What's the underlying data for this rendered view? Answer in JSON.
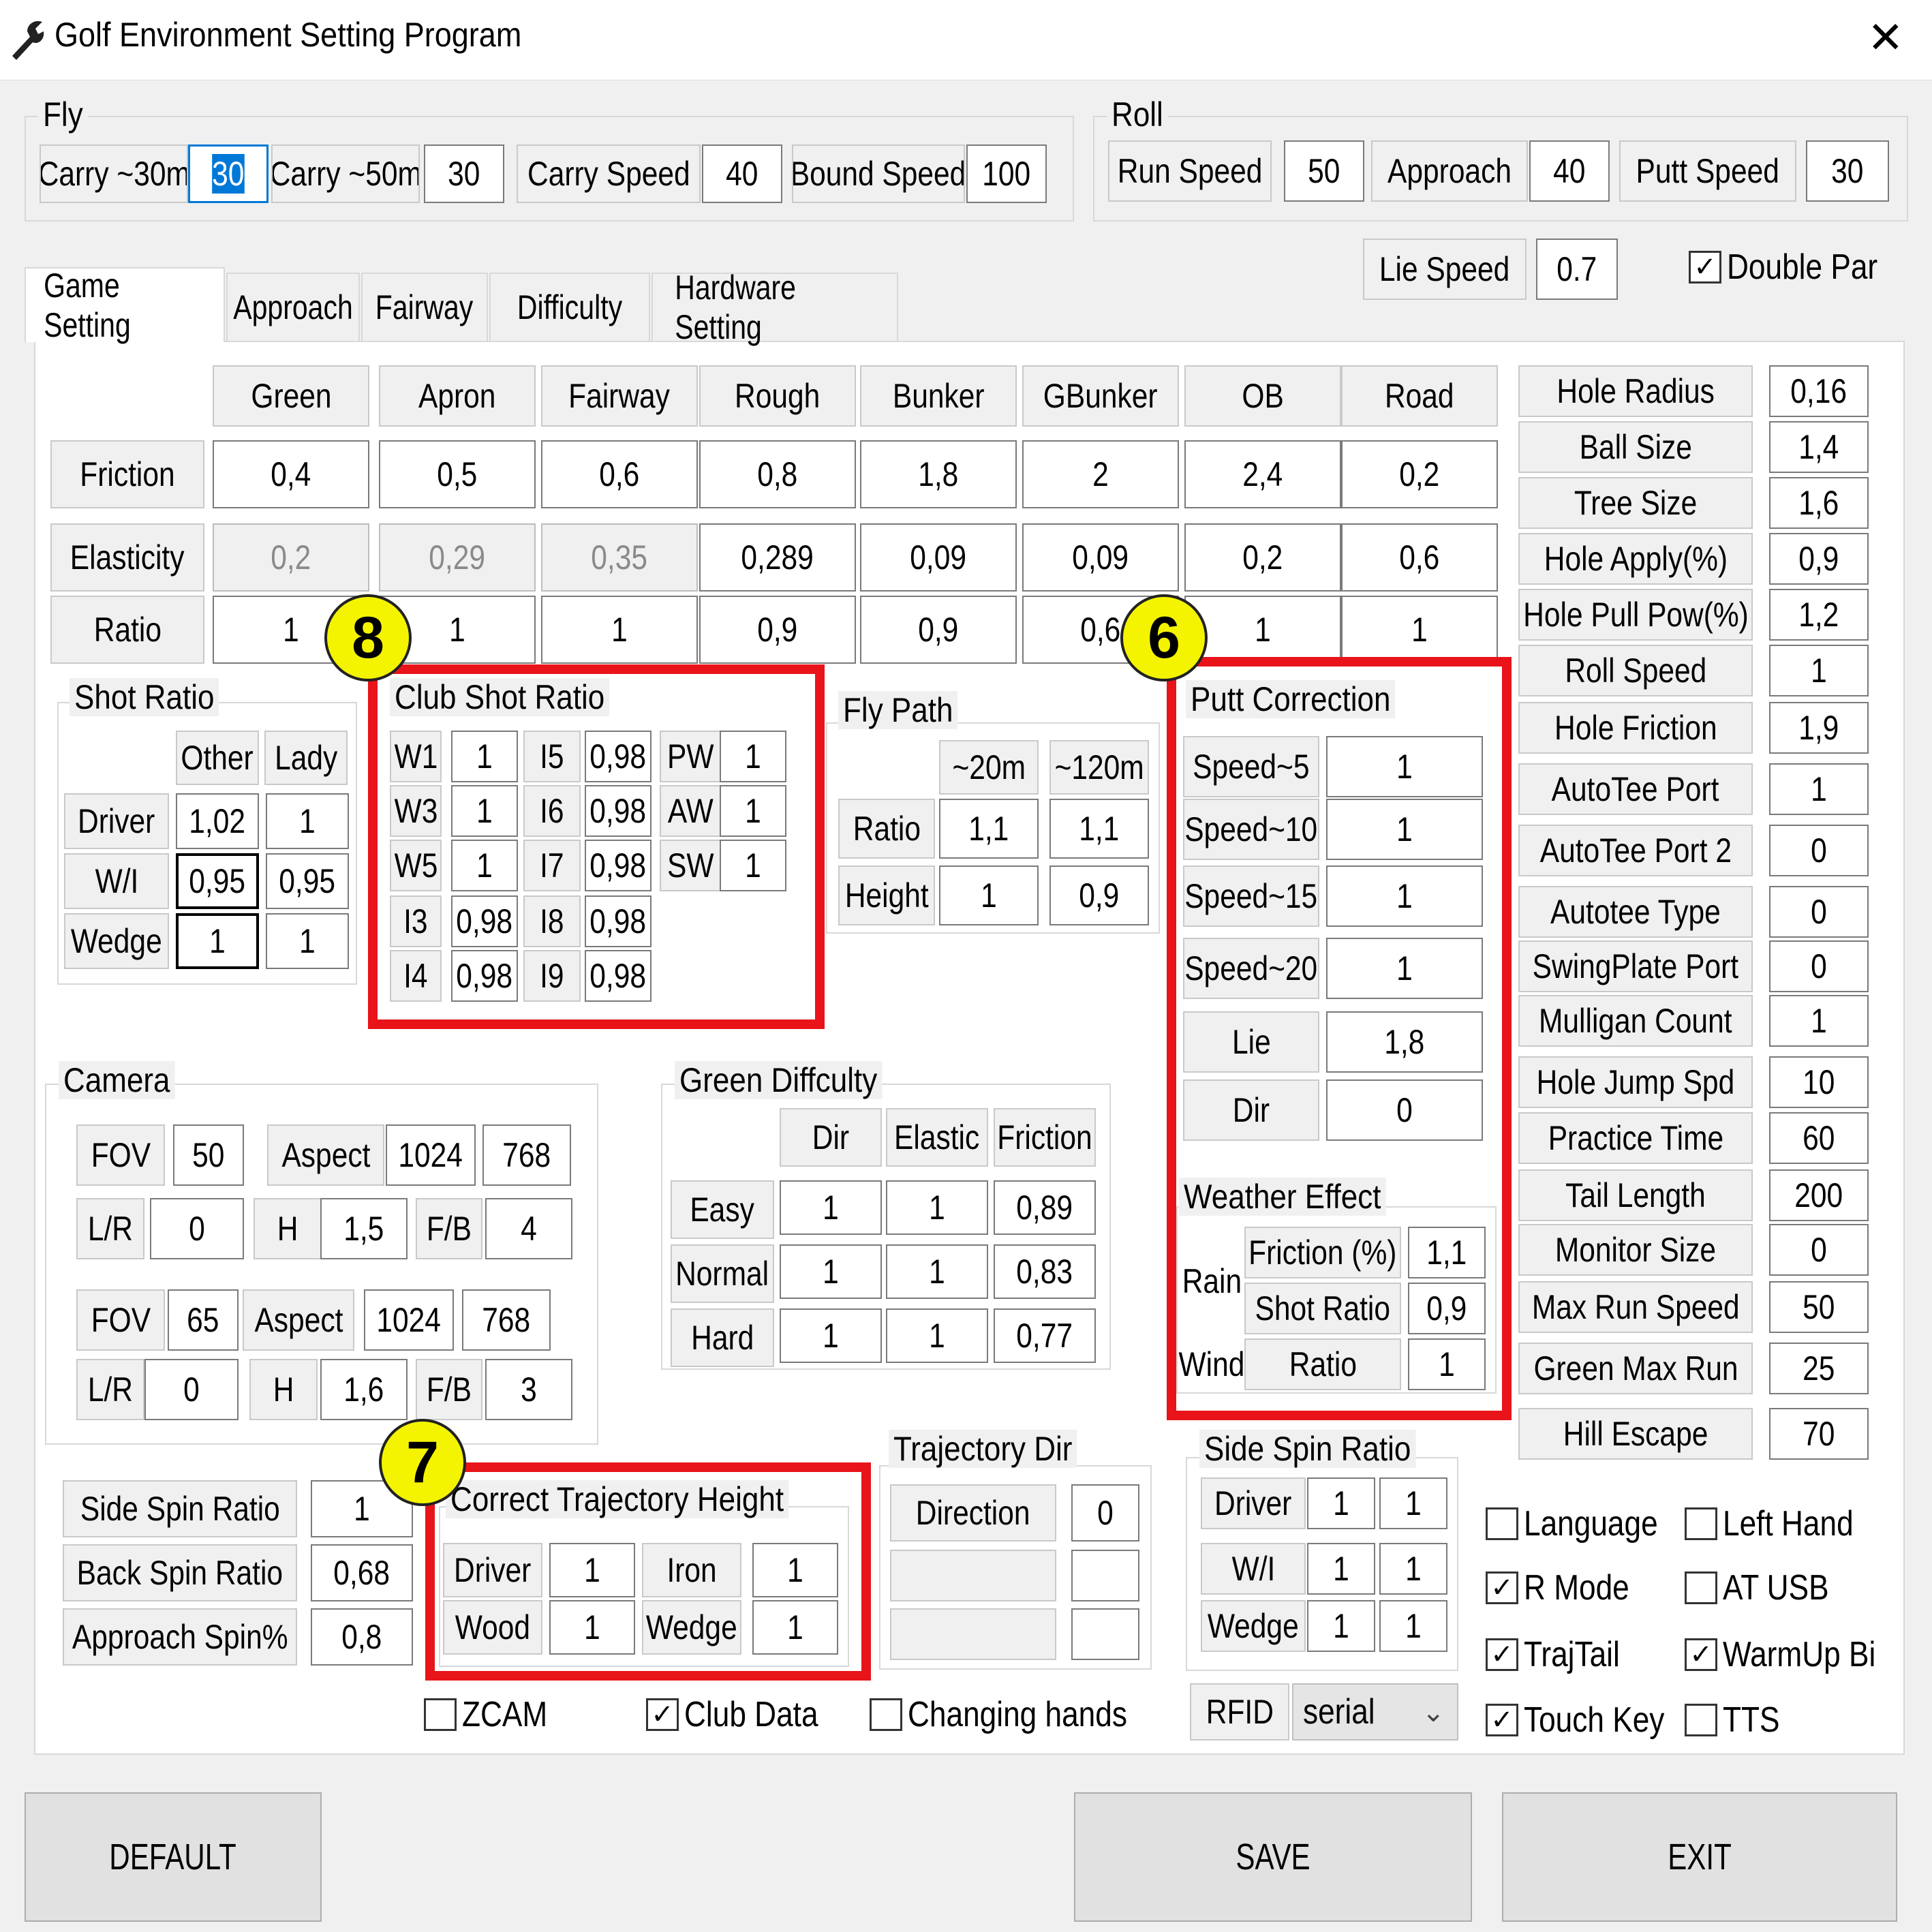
{
  "window": {
    "title": "Golf Environment Setting Program"
  },
  "fly": {
    "label": "Fly",
    "carry30_label": "Carry ~30m",
    "carry30_value": "30",
    "carry50_label": "Carry ~50m",
    "carry50_value": "30",
    "carry_speed_label": "Carry Speed",
    "carry_speed_value": "40",
    "bound_speed_label": "Bound Speed",
    "bound_speed_value": "100"
  },
  "roll": {
    "label": "Roll",
    "run_speed_label": "Run Speed",
    "run_speed_value": "50",
    "approach_label": "Approach",
    "approach_value": "40",
    "putt_speed_label": "Putt Speed",
    "putt_speed_value": "30",
    "lie_speed_label": "Lie Speed",
    "lie_speed_value": "0.7",
    "double_par_label": "Double Par",
    "double_par_checked": true
  },
  "tabs": [
    "Game Setting",
    "Approach",
    "Fairway",
    "Difficulty",
    "Hardware Setting"
  ],
  "surface": {
    "columns": [
      "Green",
      "Apron",
      "Fairway",
      "Rough",
      "Bunker",
      "GBunker",
      "OB",
      "Road"
    ],
    "rows": [
      {
        "label": "Friction",
        "values": [
          "0,4",
          "0,5",
          "0,6",
          "0,8",
          "1,8",
          "2",
          "2,4",
          "0,2"
        ]
      },
      {
        "label": "Elasticity",
        "values": [
          "0,2",
          "0,29",
          "0,35",
          "0,289",
          "0,09",
          "0,09",
          "0,2",
          "0,6"
        ]
      },
      {
        "label": "Ratio",
        "values": [
          "1",
          "1",
          "1",
          "0,9",
          "0,9",
          "0,6",
          "1",
          "1"
        ]
      }
    ]
  },
  "right_params": [
    {
      "label": "Hole Radius",
      "value": "0,16"
    },
    {
      "label": "Ball Size",
      "value": "1,4"
    },
    {
      "label": "Tree Size",
      "value": "1,6"
    },
    {
      "label": "Hole Apply(%)",
      "value": "0,9"
    },
    {
      "label": "Hole Pull Pow(%)",
      "value": "1,2"
    },
    {
      "label": "Roll Speed",
      "value": "1"
    },
    {
      "label": "Hole Friction",
      "value": "1,9"
    },
    {
      "label": "AutoTee Port",
      "value": "1"
    },
    {
      "label": "AutoTee Port 2",
      "value": "0"
    },
    {
      "label": "Autotee Type",
      "value": "0"
    },
    {
      "label": "SwingPlate Port",
      "value": "0"
    },
    {
      "label": "Mulligan Count",
      "value": "1"
    },
    {
      "label": "Hole Jump Spd",
      "value": "10"
    },
    {
      "label": "Practice Time",
      "value": "60"
    },
    {
      "label": "Tail Length",
      "value": "200"
    },
    {
      "label": "Monitor Size",
      "value": "0"
    },
    {
      "label": "Max Run Speed",
      "value": "50"
    },
    {
      "label": "Green Max Run",
      "value": "25"
    },
    {
      "label": "Hill Escape",
      "value": "70"
    }
  ],
  "shot_ratio": {
    "label": "Shot Ratio",
    "col_other": "Other",
    "col_lady": "Lady",
    "rows": [
      {
        "label": "Driver",
        "other": "1,02",
        "lady": "1"
      },
      {
        "label": "W/I",
        "other": "0,95",
        "lady": "0,95"
      },
      {
        "label": "Wedge",
        "other": "1",
        "lady": "1"
      }
    ]
  },
  "club_shot_ratio": {
    "label": "Club Shot Ratio",
    "col1": [
      {
        "label": "W1",
        "value": "1"
      },
      {
        "label": "W3",
        "value": "1"
      },
      {
        "label": "W5",
        "value": "1"
      },
      {
        "label": "I3",
        "value": "0,98"
      },
      {
        "label": "I4",
        "value": "0,98"
      }
    ],
    "col2": [
      {
        "label": "I5",
        "value": "0,98"
      },
      {
        "label": "I6",
        "value": "0,98"
      },
      {
        "label": "I7",
        "value": "0,98"
      },
      {
        "label": "I8",
        "value": "0,98"
      },
      {
        "label": "I9",
        "value": "0,98"
      }
    ],
    "col3": [
      {
        "label": "PW",
        "value": "1"
      },
      {
        "label": "AW",
        "value": "1"
      },
      {
        "label": "SW",
        "value": "1"
      }
    ]
  },
  "fly_path": {
    "label": "Fly Path",
    "col1": "~20m",
    "col2": "~120m",
    "ratio_label": "Ratio",
    "ratio1": "1,1",
    "ratio2": "1,1",
    "height_label": "Height",
    "height1": "1",
    "height2": "0,9"
  },
  "putt_correction": {
    "label": "Putt Correction",
    "rows": [
      {
        "label": "Speed~5",
        "value": "1"
      },
      {
        "label": "Speed~10",
        "value": "1"
      },
      {
        "label": "Speed~15",
        "value": "1"
      },
      {
        "label": "Speed~20",
        "value": "1"
      },
      {
        "label": "Lie",
        "value": "1,8"
      },
      {
        "label": "Dir",
        "value": "0"
      }
    ],
    "weather_label": "Weather Effect",
    "rain_label": "Rain",
    "rain_friction_label": "Friction (%)",
    "rain_friction_value": "1,1",
    "rain_shot_label": "Shot Ratio",
    "rain_shot_value": "0,9",
    "wind_label": "Wind",
    "wind_ratio_label": "Ratio",
    "wind_ratio_value": "1"
  },
  "camera": {
    "label": "Camera",
    "set1": {
      "fov_label": "FOV",
      "fov": "50",
      "aspect_label": "Aspect",
      "aspect_w": "1024",
      "aspect_h": "768",
      "lr_label": "L/R",
      "lr": "0",
      "h_label": "H",
      "h": "1,5",
      "fb_label": "F/B",
      "fb": "4"
    },
    "set2": {
      "fov_label": "FOV",
      "fov": "65",
      "aspect_label": "Aspect",
      "aspect_w": "1024",
      "aspect_h": "768",
      "lr_label": "L/R",
      "lr": "0",
      "h_label": "H",
      "h": "1,6",
      "fb_label": "F/B",
      "fb": "3"
    }
  },
  "green_difficulty": {
    "label": "Green Diffculty",
    "cols": [
      "Dir",
      "Elastic",
      "Friction"
    ],
    "rows": [
      {
        "label": "Easy",
        "values": [
          "1",
          "1",
          "0,89"
        ]
      },
      {
        "label": "Normal",
        "values": [
          "1",
          "1",
          "0,83"
        ]
      },
      {
        "label": "Hard",
        "values": [
          "1",
          "1",
          "0,77"
        ]
      }
    ]
  },
  "spin": {
    "side_label": "Side Spin Ratio",
    "side_value": "1",
    "back_label": "Back Spin Ratio",
    "back_value": "0,68",
    "approach_label": "Approach Spin%",
    "approach_value": "0,8"
  },
  "trajectory_height": {
    "label": "Correct Trajectory Height",
    "driver_label": "Driver",
    "driver_value": "1",
    "iron_label": "Iron",
    "iron_value": "1",
    "wood_label": "Wood",
    "wood_value": "1",
    "wedge_label": "Wedge",
    "wedge_value": "1"
  },
  "trajectory_dir": {
    "label": "Trajectory Dir",
    "direction_label": "Direction",
    "direction_value": "0"
  },
  "side_spin_ratio": {
    "label": "Side Spin Ratio",
    "rows": [
      {
        "label": "Driver",
        "v1": "1",
        "v2": "1"
      },
      {
        "label": "W/I",
        "v1": "1",
        "v2": "1"
      },
      {
        "label": "Wedge",
        "v1": "1",
        "v2": "1"
      }
    ]
  },
  "rfid": {
    "label": "RFID",
    "value": "serial"
  },
  "checkboxes_bottom": [
    {
      "label": "ZCAM",
      "checked": false
    },
    {
      "label": "Club Data",
      "checked": true
    },
    {
      "label": "Changing hands",
      "checked": false
    }
  ],
  "checkboxes_right": [
    {
      "label": "Language",
      "checked": false
    },
    {
      "label": "Left Hand",
      "checked": false
    },
    {
      "label": "R Mode",
      "checked": true
    },
    {
      "label": "AT USB",
      "checked": false
    },
    {
      "label": "TrajTail",
      "checked": true
    },
    {
      "label": "WarmUp Bi",
      "checked": true
    },
    {
      "label": "Touch Key",
      "checked": true
    },
    {
      "label": "TTS",
      "checked": false
    }
  ],
  "buttons": {
    "default": "DEFAULT",
    "save": "SAVE",
    "exit": "EXIT"
  },
  "badges": {
    "six": "6",
    "seven": "7",
    "eight": "8"
  },
  "annotation_color": "#e8141a",
  "badge_color": "#f4f400"
}
